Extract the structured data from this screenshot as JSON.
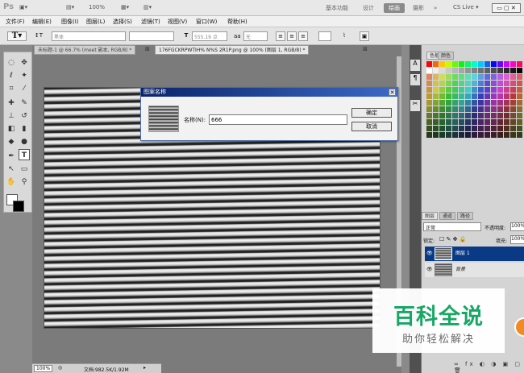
{
  "app": {
    "logo": "Ps",
    "zoom": "100%"
  },
  "workspaces": [
    "基本功能",
    "设计",
    "绘画",
    "摄影",
    "»"
  ],
  "active_workspace": "绘画",
  "cs_live": "CS Live ▾",
  "menu": [
    "文件(F)",
    "编辑(E)",
    "图像(I)",
    "图层(L)",
    "选择(S)",
    "滤镜(T)",
    "视图(V)",
    "窗口(W)",
    "帮助(H)"
  ],
  "options": {
    "font_family": "黑体",
    "font_size": "555.19 点",
    "aa_label": "aa",
    "aa_value": "无"
  },
  "tabs": [
    {
      "label": "未标题-1 @ 66.7% (meet 副本, RGB/8) *",
      "active": false
    },
    {
      "label": "176FGCKRPWTIH% N%S 2R1P.png @ 100% (图层 1, RGB/8) *",
      "active": true
    }
  ],
  "status": {
    "zoom": "100%",
    "doc": "文档:982.5K/1.92M"
  },
  "panels": {
    "swatch_tabs": [
      "色板",
      "颜色"
    ],
    "layer_tabs": [
      "图层",
      "通道",
      "路径"
    ],
    "blend_mode": "正常",
    "opacity_label": "不透明度:",
    "opacity_value": "100%",
    "lock_label": "锁定:",
    "fill_label": "填充:",
    "fill_value": "100%",
    "layers": [
      {
        "name": "图层 1",
        "selected": true
      },
      {
        "name": "背景",
        "selected": false
      }
    ]
  },
  "dialog": {
    "title": "图案名称",
    "name_label": "名称(N):",
    "name_value": "666",
    "ok": "确定",
    "cancel": "取消"
  },
  "watermark": {
    "title": "百科全说",
    "subtitle": "助你轻松解决"
  },
  "colors": {
    "title_bar": "#0a246a",
    "watermark_green": "#17a765",
    "badge": "#f08a24"
  }
}
